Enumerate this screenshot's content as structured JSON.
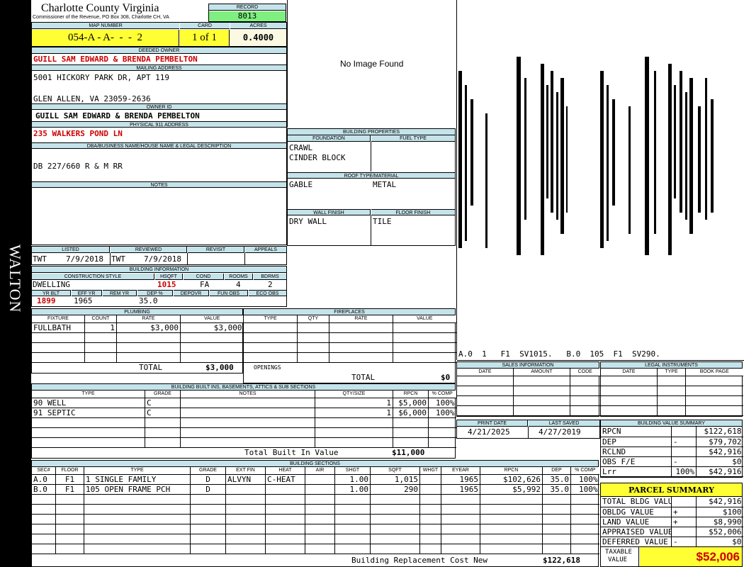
{
  "header": {
    "county": "Charlotte County Virginia",
    "commissioner": "Commissioner of the Revenue, PO Box 308, Charlotte CH, VA",
    "record_label": "RECORD",
    "record": "8013",
    "map_label": "MAP NUMBER",
    "map_number": "054-A - A-  -  -  2",
    "card_label": "CARD",
    "card": "1 of 1",
    "acres_label": "ACRES",
    "acres": "0.4000"
  },
  "district": "WALTON",
  "owner": {
    "deeded_label": "DEEDED OWNER",
    "deeded": "GUILL SAM EDWARD & BRENDA PEMBELTON",
    "mailing_label": "MAILING ADDRESS",
    "mailing1": "5001 HICKORY PARK DR, APT 119",
    "mailing2": "GLEN ALLEN, VA 23059-2636",
    "owner_id_label": "OWNER ID",
    "owner_id": "GUILL SAM EDWARD & BRENDA PEMBELTON",
    "physical_label": "PHYSICAL 911 ADDRESS",
    "physical": "235 WALKERS POND LN",
    "dba_label": "DBA/BUSINESS NAME/HOUSE NAME & LEGAL DESCRIPTION",
    "legal": "DB 227/660 R & M RR",
    "notes_label": "NOTES"
  },
  "image_text": "No Image Found",
  "building_props": {
    "label": "BUILDING PROPERTIES",
    "foundation_label": "FOUNDATION",
    "fuel_label": "FUEL TYPE",
    "foundation1": "CRAWL",
    "foundation2": "CINDER BLOCK",
    "roof_label": "ROOF TYPE/MATERIAL",
    "roof_type": "GABLE",
    "roof_mat": "METAL",
    "wall_label": "WALL FINISH",
    "floor_label": "FLOOR FINISH",
    "wall": "DRY WALL",
    "floor": "TILE"
  },
  "sketch_caption": "A.0  1   F1  SV1015.   B.0  105  F1  SV290.",
  "barcode_text": "A.0 1 F1 SV1015. B.0 105 F1 SV290.",
  "listed": {
    "listed_label": "LISTED",
    "reviewed_label": "REVIEWED",
    "revisit_label": "REVISIT",
    "appeals_label": "APPEALS",
    "listed_by": "TWT",
    "listed_date": "7/9/2018",
    "reviewed_by": "TWT",
    "reviewed_date": "7/9/2018"
  },
  "building_info": {
    "label": "BUILDING INFORMATION",
    "style_label": "CONSTRUCTION STYLE",
    "hsqft_label": "HSQFT",
    "cond_label": "COND",
    "rooms_label": "ROOMS",
    "bdrms_label": "BDRMS",
    "style": "DWELLING",
    "hsqft": "1015",
    "cond": "FA",
    "rooms": "4",
    "bdrms": "2",
    "yrblt_label": "YR BLT",
    "effyr_label": "EFF YR",
    "remyr_label": "REM YR",
    "dep_label": "DEP %",
    "depovr_label": "DEPOVR",
    "funobs_label": "FUN OBS",
    "ecoobs_label": "ECO OBS",
    "yrblt": "1899",
    "effyr": "1965",
    "dep": "35.0"
  },
  "plumbing": {
    "label": "PLUMBING",
    "headers": [
      "FIXTURE",
      "COUNT",
      "RATE",
      "VALUE"
    ],
    "rows": [
      [
        "FULLBATH",
        "1",
        "$3,000",
        "$3,000"
      ]
    ],
    "total_label": "TOTAL",
    "total": "$3,000"
  },
  "fireplaces": {
    "label": "FIREPLACES",
    "headers": [
      "TYPE",
      "QTY",
      "RATE",
      "VALUE"
    ],
    "openings_label": "OPENINGS",
    "total_label": "TOTAL",
    "total": "$0"
  },
  "builtins": {
    "label": "BUILDING BUILT INS, BASEMENTS, ATTICS & SUB SECTIONS",
    "headers": [
      "TYPE",
      "GRADE",
      "NOTES",
      "QTY/SIZE",
      "RPCN",
      "% COMP"
    ],
    "rows": [
      [
        "90 WELL",
        "C",
        "",
        "1",
        "$5,000",
        "100%"
      ],
      [
        "91 SEPTIC",
        "C",
        "",
        "1",
        "$6,000",
        "100%"
      ]
    ],
    "total_label": "Total Built In Value",
    "total": "$11,000"
  },
  "sales": {
    "label": "SALES INFORMATION",
    "headers": [
      "DATE",
      "AMOUNT",
      "CODE"
    ]
  },
  "legal_instr": {
    "label": "LEGAL INSTRUMENTS",
    "headers": [
      "DATE",
      "TYPE",
      "BOOK PAGE"
    ]
  },
  "dates": {
    "print_label": "PRINT DATE",
    "saved_label": "LAST SAVED",
    "print": "4/21/2025",
    "saved": "4/27/2019"
  },
  "bvs": {
    "label": "BUILDING VALUE SUMMARY",
    "rows": [
      [
        "RPCN",
        "",
        "$122,618"
      ],
      [
        "DEP",
        "-",
        "$79,702"
      ],
      [
        "RCLND",
        "",
        "$42,916"
      ],
      [
        "OBS F/E",
        "-",
        "$0"
      ],
      [
        "Lrr",
        "100%",
        "$42,916"
      ]
    ]
  },
  "sections": {
    "label": "BUILDING SECTIONS",
    "headers": [
      "SEC#",
      "FLOOR",
      "TYPE",
      "GRADE",
      "EXT FIN",
      "HEAT",
      "AIR",
      "SHGT",
      "SQFT",
      "WHGT",
      "EYEAR",
      "RPCN",
      "DEP",
      "% COMP"
    ],
    "rows": [
      [
        "A.0",
        "F1",
        "1 SINGLE FAMILY",
        "D",
        "ALVYN",
        "C-HEAT",
        "",
        "1.00",
        "1,015",
        "",
        "1965",
        "$102,626",
        "35.0",
        "100%"
      ],
      [
        "B.0",
        "F1",
        "105 OPEN FRAME PCH",
        "D",
        "",
        "",
        "",
        "1.00",
        "290",
        "",
        "1965",
        "$5,992",
        "35.0",
        "100%"
      ]
    ],
    "total_label": "Building Replacement Cost New",
    "total": "$122,618"
  },
  "parcel": {
    "label": "PARCEL SUMMARY",
    "rows": [
      [
        "TOTAL BLDG VALUE",
        "",
        "$42,916"
      ],
      [
        "OBLDG VALUE",
        "+",
        "$100"
      ],
      [
        "LAND VALUE",
        "+",
        "$8,990"
      ],
      [
        "APPRAISED VALUE",
        "",
        "$52,006"
      ],
      [
        "DEFERRED VALUE",
        "-",
        "$0"
      ]
    ],
    "taxable_label1": "TAXABLE",
    "taxable_label2": "VALUE",
    "taxable": "$52,006"
  },
  "colors": {
    "label_bg": "#c5e3ea",
    "yellow": "#ffff33",
    "green": "#7fef7f",
    "red": "#cc0000"
  }
}
